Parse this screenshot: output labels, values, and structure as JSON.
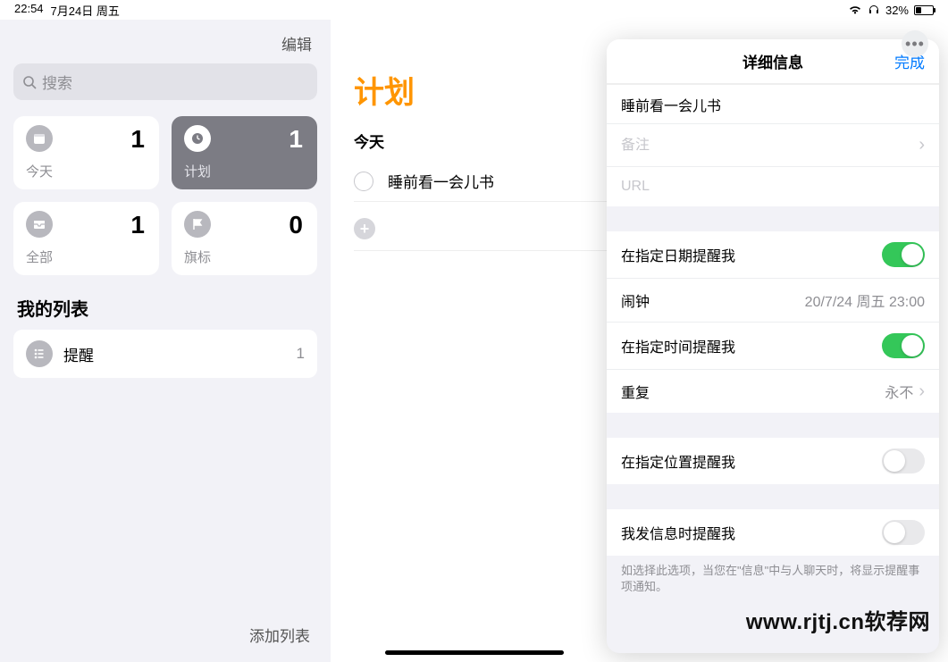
{
  "status": {
    "time": "22:54",
    "date": "7月24日 周五",
    "battery_pct": "32%"
  },
  "sidebar": {
    "edit": "编辑",
    "search_placeholder": "搜索",
    "cards": {
      "today": {
        "label": "今天",
        "count": "1"
      },
      "scheduled": {
        "label": "计划",
        "count": "1"
      },
      "all": {
        "label": "全部",
        "count": "1"
      },
      "flagged": {
        "label": "旗标",
        "count": "0"
      }
    },
    "my_lists": "我的列表",
    "lists": [
      {
        "name": "提醒",
        "count": "1"
      }
    ],
    "add_list": "添加列表"
  },
  "main": {
    "title": "计划",
    "day": "今天",
    "reminders": [
      {
        "text": "睡前看一会儿书"
      }
    ]
  },
  "panel": {
    "title": "详细信息",
    "done": "完成",
    "reminder_title": "睡前看一会儿书",
    "notes_placeholder": "备注",
    "url_placeholder": "URL",
    "remind_date_label": "在指定日期提醒我",
    "alarm_label": "闹钟",
    "alarm_value": "20/7/24 周五 23:00",
    "remind_time_label": "在指定时间提醒我",
    "repeat_label": "重复",
    "repeat_value": "永不",
    "remind_location_label": "在指定位置提醒我",
    "remind_message_label": "我发信息时提醒我",
    "message_hint": "如选择此选项，当您在\"信息\"中与人聊天时，将显示提醒事项通知。"
  },
  "watermark": "www.rjtj.cn软荐网"
}
